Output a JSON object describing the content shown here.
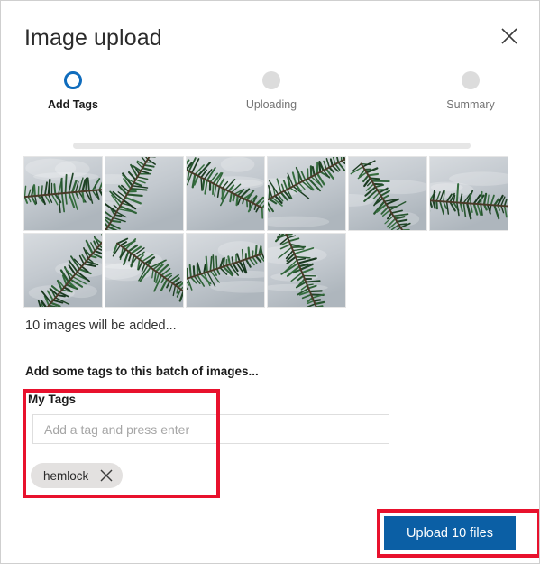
{
  "dialog": {
    "title": "Image upload",
    "close_icon": "close-icon"
  },
  "stepper": {
    "steps": [
      {
        "label": "Add Tags",
        "state": "active"
      },
      {
        "label": "Uploading",
        "state": "pending"
      },
      {
        "label": "Summary",
        "state": "pending"
      }
    ],
    "active_color": "#0f6cbd",
    "track_color": "#e6e6e6",
    "pending_dot_color": "#dcdcdc"
  },
  "thumbnails": {
    "count": 10,
    "alt": "conifer hemlock branch photo",
    "items": [
      {
        "id": "thumb-1"
      },
      {
        "id": "thumb-2"
      },
      {
        "id": "thumb-3"
      },
      {
        "id": "thumb-4"
      },
      {
        "id": "thumb-5"
      },
      {
        "id": "thumb-6"
      },
      {
        "id": "thumb-7"
      },
      {
        "id": "thumb-8"
      },
      {
        "id": "thumb-9"
      },
      {
        "id": "thumb-10"
      }
    ]
  },
  "status": {
    "images_count_text": "10 images will be added..."
  },
  "tags": {
    "prompt": "Add some tags to this batch of images...",
    "field_label": "My Tags",
    "input_value": "",
    "input_placeholder": "Add a tag and press enter",
    "chips": [
      {
        "label": "hemlock",
        "remove_icon": "close-icon"
      }
    ]
  },
  "footer": {
    "upload_label": "Upload 10 files",
    "upload_color": "#0b5fa5"
  },
  "annotations": {
    "color": "#e8112d",
    "boxes": [
      {
        "name": "tags-section-highlight"
      },
      {
        "name": "upload-button-highlight"
      }
    ]
  }
}
